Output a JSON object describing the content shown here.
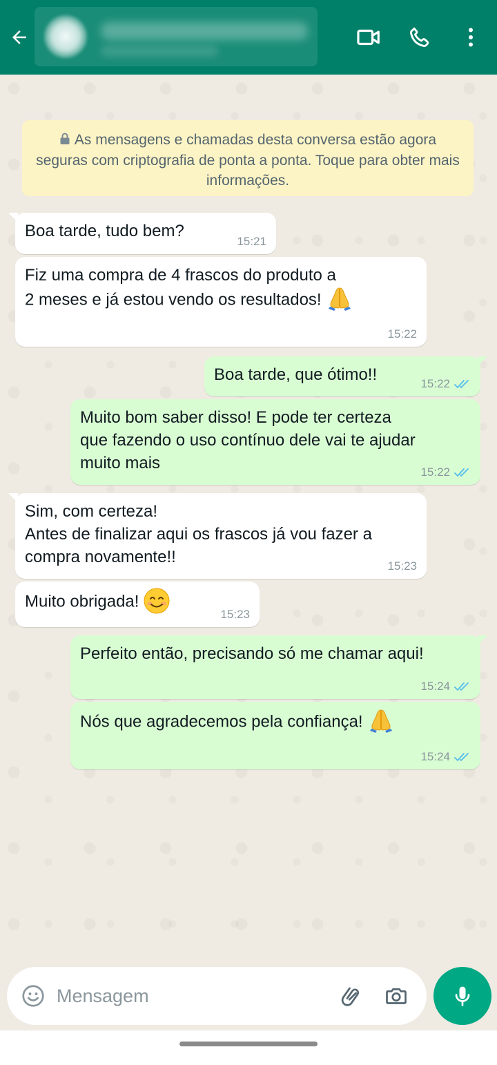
{
  "header": {
    "back_icon": "arrow-left-icon",
    "video_icon": "video-camera-icon",
    "call_icon": "phone-icon",
    "menu_icon": "more-vertical-icon",
    "color": "#008069"
  },
  "notice": {
    "icon": "lock-icon",
    "text": "As mensagens e chamadas desta conversa estão agora seguras com criptografia de ponta a ponta. Toque para obter mais informações."
  },
  "messages": [
    {
      "direction": "incoming",
      "lines": [
        "Boa tarde, tudo bem?"
      ],
      "time": "15:21"
    },
    {
      "direction": "incoming",
      "lines": [
        "Fiz uma compra de 4 frascos do produto a",
        "2 meses e já estou vendo os resultados!"
      ],
      "emoji": "folded-hands-emoji",
      "time": "15:22"
    },
    {
      "direction": "outgoing",
      "lines": [
        "Boa tarde, que ótimo!!"
      ],
      "time": "15:22",
      "status": "read"
    },
    {
      "direction": "outgoing",
      "lines": [
        "Muito bom saber disso! E pode ter certeza",
        "que fazendo o uso contínuo dele vai te ajudar",
        "muito mais"
      ],
      "time": "15:22",
      "status": "read"
    },
    {
      "direction": "incoming",
      "lines": [
        "Sim, com certeza!",
        "Antes de finalizar aqui os frascos já vou fazer a",
        "compra novamente!!"
      ],
      "time": "15:23"
    },
    {
      "direction": "incoming",
      "lines": [
        "Muito obrigada!"
      ],
      "emoji": "smiling-face-emoji",
      "time": "15:23"
    },
    {
      "direction": "outgoing",
      "lines": [
        "Perfeito então, precisando só me chamar aqui!"
      ],
      "time": "15:24",
      "status": "read"
    },
    {
      "direction": "outgoing",
      "lines": [
        "Nós que agradecemos pela confiança!"
      ],
      "emoji": "folded-hands-emoji",
      "time": "15:24",
      "status": "read"
    }
  ],
  "composer": {
    "placeholder": "Mensagem",
    "value": "",
    "emoji_icon": "smiley-icon",
    "attach_icon": "paperclip-icon",
    "camera_icon": "camera-icon",
    "mic_icon": "microphone-icon"
  },
  "colors": {
    "incoming_bubble": "#ffffff",
    "outgoing_bubble": "#d9fdd3",
    "notice_bg": "#fdf4c5",
    "read_ticks": "#53bdeb",
    "mic_button": "#00a884"
  }
}
